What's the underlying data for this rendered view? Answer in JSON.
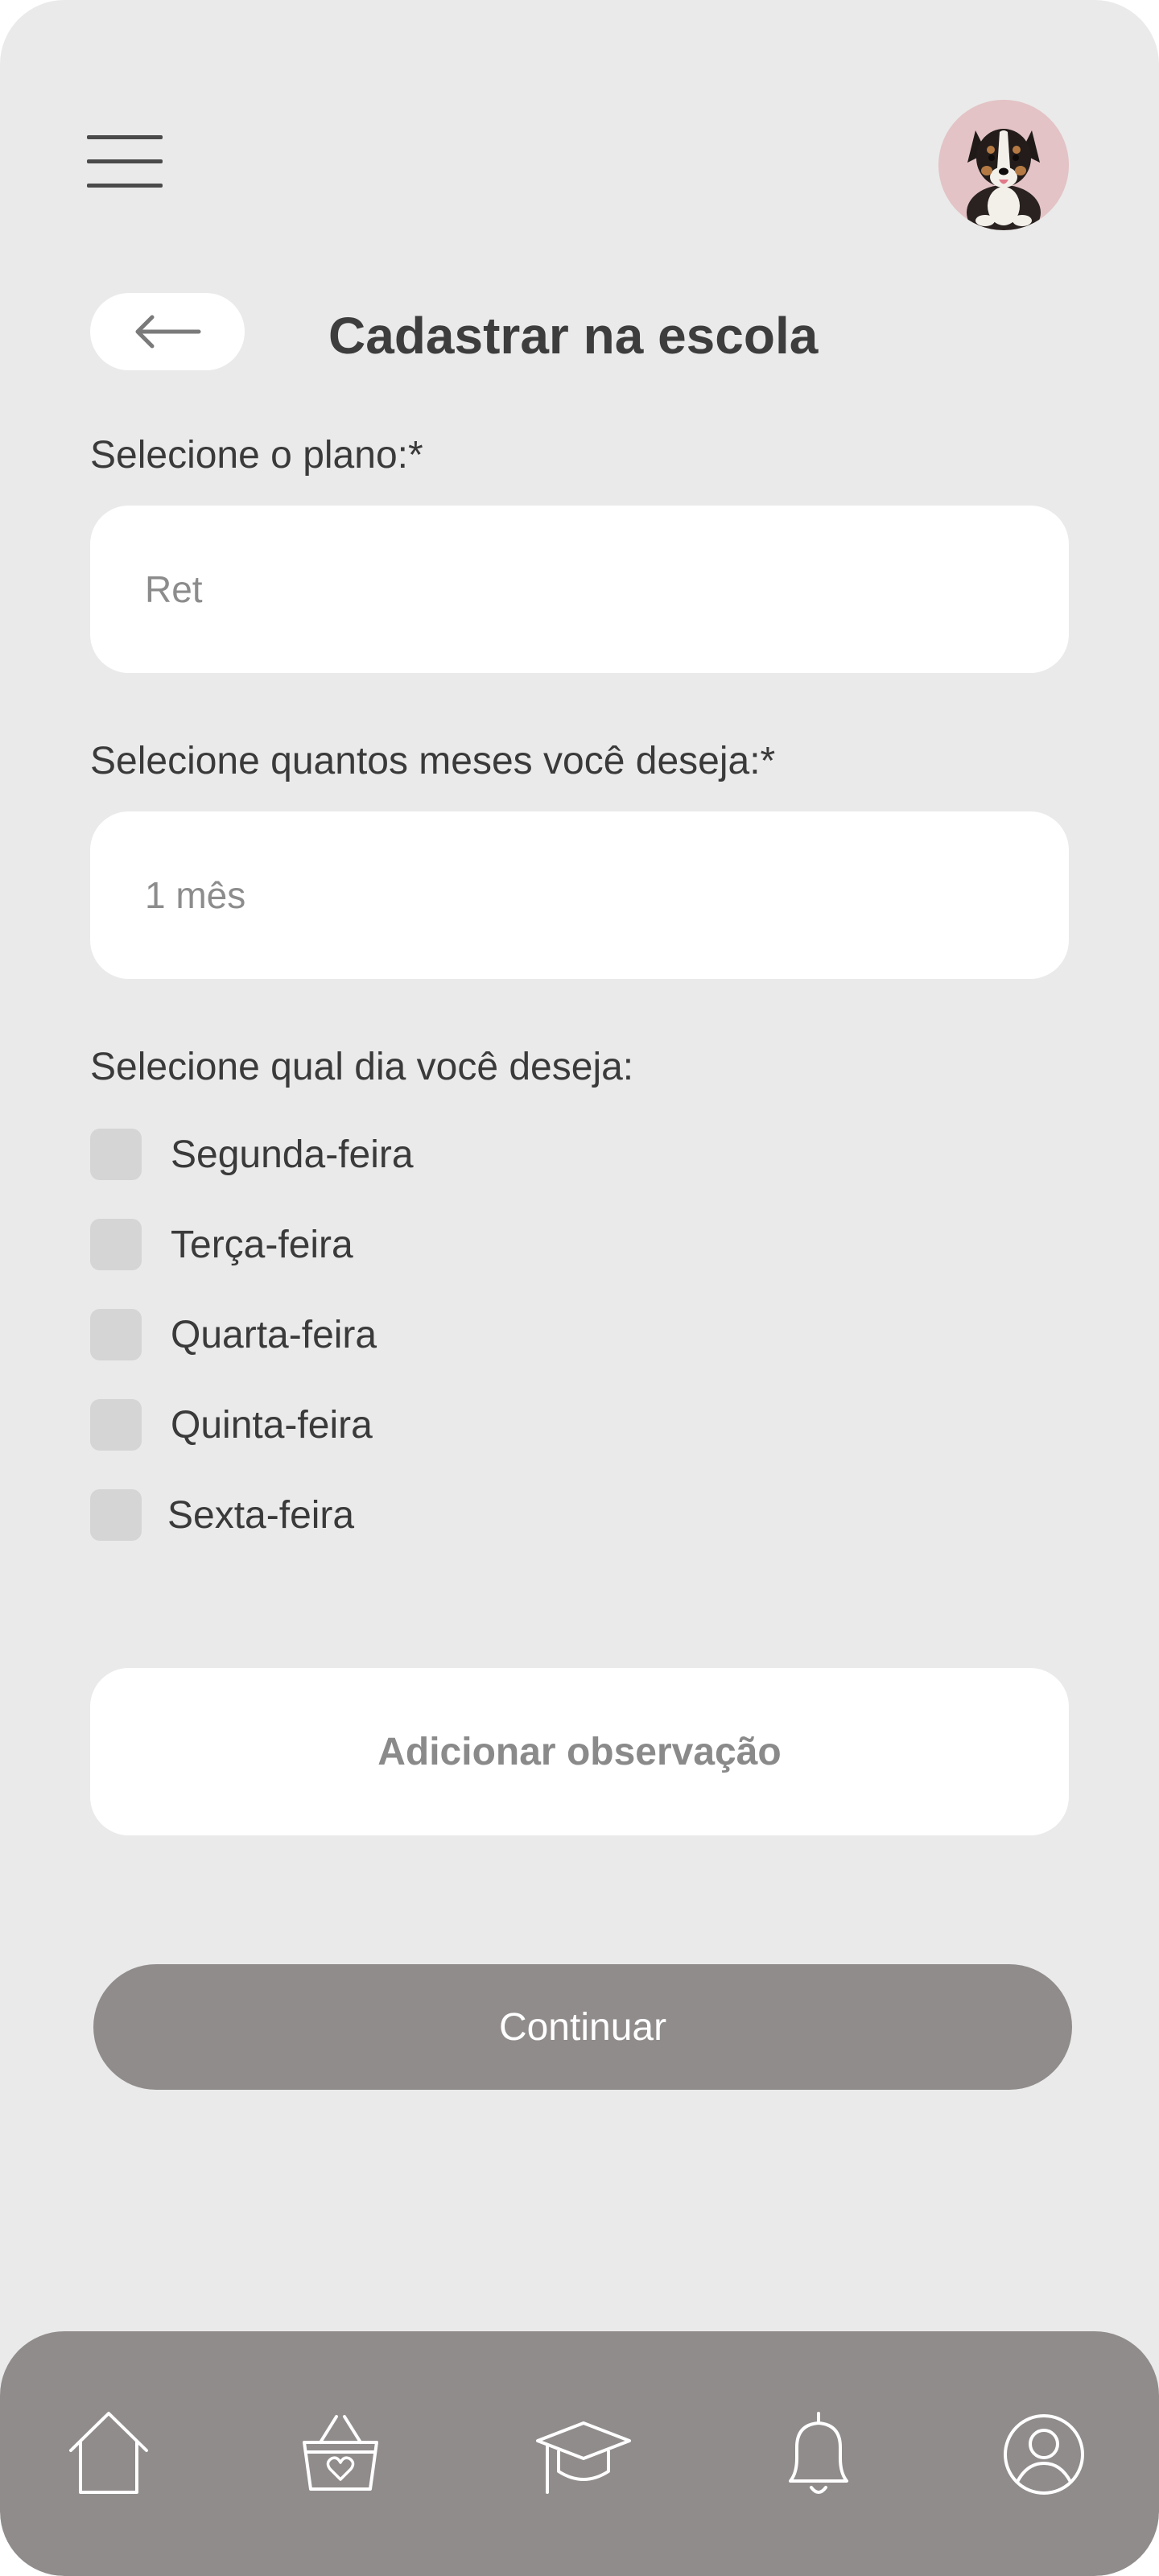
{
  "header": {
    "menu_icon": "hamburger-menu-icon",
    "avatar_icon": "dog-avatar"
  },
  "title_bar": {
    "back_icon": "arrow-left-icon",
    "title": "Cadastrar na escola"
  },
  "form": {
    "plan": {
      "label": "Selecione o plano:*",
      "value": "Ret"
    },
    "months": {
      "label": "Selecione quantos meses você deseja:*",
      "value": "1 mês"
    },
    "days": {
      "label": "Selecione qual dia você deseja:",
      "options": [
        {
          "label": "Segunda-feira",
          "checked": false
        },
        {
          "label": "Terça-feira",
          "checked": false
        },
        {
          "label": "Quarta-feira",
          "checked": false
        },
        {
          "label": "Quinta-feira",
          "checked": false
        },
        {
          "label": "Sexta-feira",
          "checked": false
        }
      ]
    },
    "observation_label": "Adicionar observação",
    "continue_label": "Continuar"
  },
  "bottom_nav": {
    "items": [
      {
        "icon": "home-icon"
      },
      {
        "icon": "shopping-basket-icon"
      },
      {
        "icon": "graduation-cap-icon"
      },
      {
        "icon": "bell-icon"
      },
      {
        "icon": "user-profile-icon"
      }
    ]
  },
  "colors": {
    "background": "#eaeaea",
    "surface": "#ffffff",
    "accent": "#918c8c",
    "text": "#3a3a3a",
    "placeholder": "#8c8c8c",
    "checkbox": "#d5d5d5",
    "avatar_bg": "#e3c3c5"
  }
}
